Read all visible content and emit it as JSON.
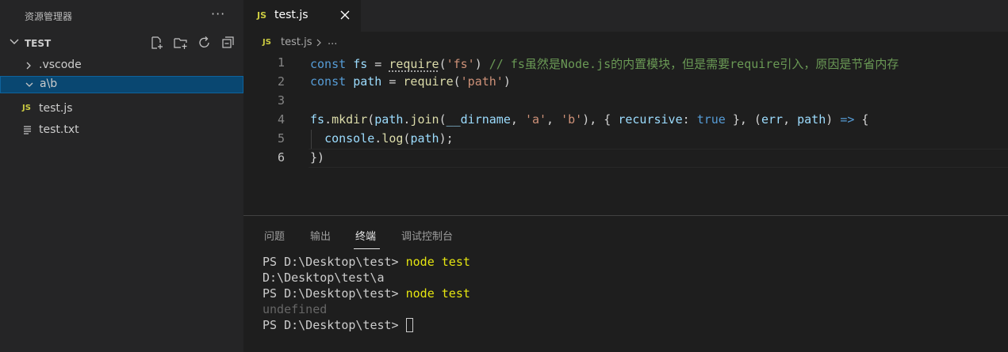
{
  "sidebar": {
    "title": "资源管理器",
    "more_label": "···",
    "folder": "TEST",
    "items": [
      {
        "label": ".vscode"
      },
      {
        "label": "a\\b"
      },
      {
        "label": "test.js"
      },
      {
        "label": "test.txt"
      }
    ]
  },
  "editor": {
    "tab": {
      "badge": "JS",
      "title": "test.js"
    },
    "breadcrumb": {
      "badge": "JS",
      "file": "test.js",
      "more": "..."
    },
    "line_numbers": [
      "1",
      "2",
      "3",
      "4",
      "5",
      "6"
    ],
    "lines": [
      [
        {
          "t": "const",
          "c": "kw"
        },
        {
          "t": " "
        },
        {
          "t": "fs",
          "c": "var"
        },
        {
          "t": " = "
        },
        {
          "t": "require",
          "c": "fn req-dots"
        },
        {
          "t": "("
        },
        {
          "t": "'fs'",
          "c": "str"
        },
        {
          "t": ") "
        },
        {
          "t": "// fs虽然是Node.js的内置模块，但是需要require引入，原因是节省内存",
          "c": "cmt"
        }
      ],
      [
        {
          "t": "const",
          "c": "kw"
        },
        {
          "t": " "
        },
        {
          "t": "path",
          "c": "var"
        },
        {
          "t": " = "
        },
        {
          "t": "require",
          "c": "fn"
        },
        {
          "t": "("
        },
        {
          "t": "'path'",
          "c": "str"
        },
        {
          "t": ")"
        }
      ],
      [],
      [
        {
          "t": "fs",
          "c": "var"
        },
        {
          "t": "."
        },
        {
          "t": "mkdir",
          "c": "fn"
        },
        {
          "t": "("
        },
        {
          "t": "path",
          "c": "var"
        },
        {
          "t": "."
        },
        {
          "t": "join",
          "c": "fn"
        },
        {
          "t": "("
        },
        {
          "t": "__dirname",
          "c": "var"
        },
        {
          "t": ", "
        },
        {
          "t": "'a'",
          "c": "str"
        },
        {
          "t": ", "
        },
        {
          "t": "'b'",
          "c": "str"
        },
        {
          "t": "), { "
        },
        {
          "t": "recursive",
          "c": "var"
        },
        {
          "t": ": "
        },
        {
          "t": "true",
          "c": "kw"
        },
        {
          "t": " }, ("
        },
        {
          "t": "err",
          "c": "var"
        },
        {
          "t": ", "
        },
        {
          "t": "path",
          "c": "var"
        },
        {
          "t": ") "
        },
        {
          "t": "=>",
          "c": "kw"
        },
        {
          "t": " {"
        }
      ],
      [
        {
          "t": "  "
        },
        {
          "t": "console",
          "c": "var"
        },
        {
          "t": "."
        },
        {
          "t": "log",
          "c": "fn"
        },
        {
          "t": "("
        },
        {
          "t": "path",
          "c": "var"
        },
        {
          "t": ");"
        }
      ],
      [
        {
          "t": "})"
        }
      ]
    ]
  },
  "panel": {
    "tabs": [
      {
        "label": "问题"
      },
      {
        "label": "输出"
      },
      {
        "label": "终端"
      },
      {
        "label": "调试控制台"
      }
    ],
    "active_tab": 2,
    "terminal": {
      "prompt": "PS D:\\Desktop\\test> ",
      "cmd1": "node test",
      "out1": "D:\\Desktop\\test\\a",
      "cmd2": "node test",
      "out2": "undefined"
    }
  },
  "colors": {
    "js_badge": "#cbcb41",
    "selection": "#094771",
    "terminal_command": "#e5e510"
  }
}
